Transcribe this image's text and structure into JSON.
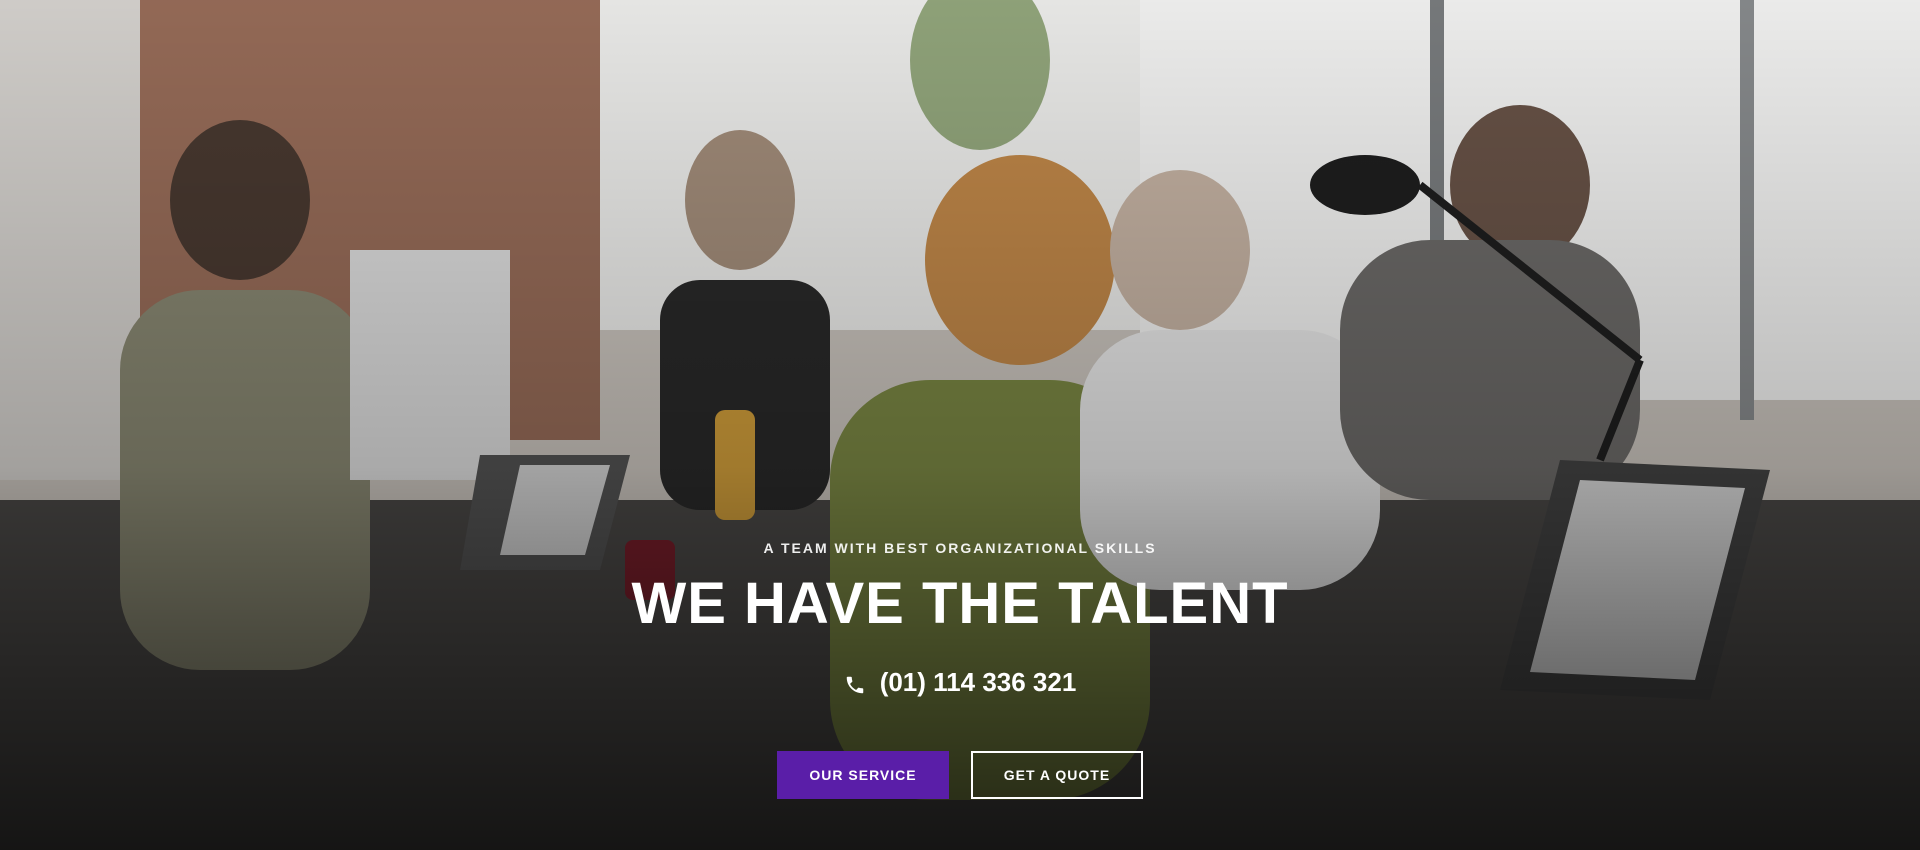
{
  "hero": {
    "kicker": "A TEAM WITH BEST ORGANIZATIONAL SKILLS",
    "headline": "WE HAVE THE TALENT",
    "phone": "(01) 114 336 321",
    "phone_icon": "phone-icon",
    "buttons": {
      "primary_label": "OUR SERVICE",
      "secondary_label": "GET A QUOTE"
    }
  },
  "colors": {
    "accent": "#5a1ea8",
    "text": "#ffffff"
  }
}
